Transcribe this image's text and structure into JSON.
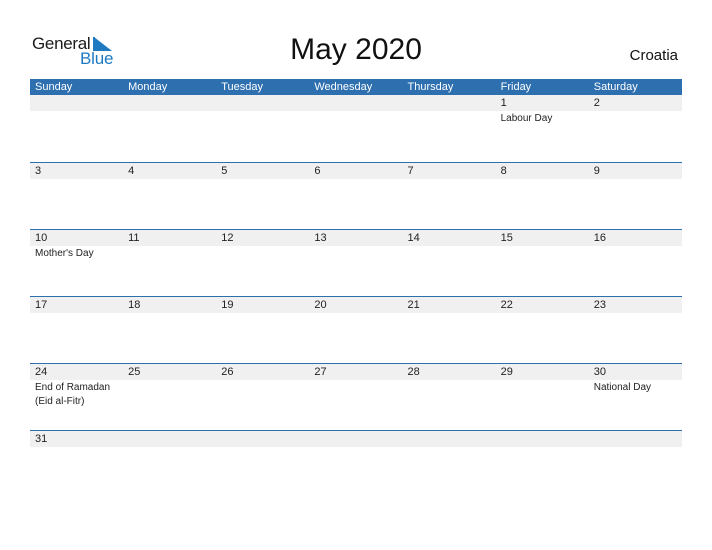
{
  "logo": {
    "line1": "General",
    "line2": "Blue"
  },
  "title": "May 2020",
  "country": "Croatia",
  "colors": {
    "header_bg": "#2e6fb0",
    "date_strip": "#f0f0f0",
    "brand_blue": "#1f7ac2"
  },
  "weekdays": [
    "Sunday",
    "Monday",
    "Tuesday",
    "Wednesday",
    "Thursday",
    "Friday",
    "Saturday"
  ],
  "weeks": [
    [
      {
        "day": "",
        "event": ""
      },
      {
        "day": "",
        "event": ""
      },
      {
        "day": "",
        "event": ""
      },
      {
        "day": "",
        "event": ""
      },
      {
        "day": "",
        "event": ""
      },
      {
        "day": "1",
        "event": "Labour Day"
      },
      {
        "day": "2",
        "event": ""
      }
    ],
    [
      {
        "day": "3",
        "event": ""
      },
      {
        "day": "4",
        "event": ""
      },
      {
        "day": "5",
        "event": ""
      },
      {
        "day": "6",
        "event": ""
      },
      {
        "day": "7",
        "event": ""
      },
      {
        "day": "8",
        "event": ""
      },
      {
        "day": "9",
        "event": ""
      }
    ],
    [
      {
        "day": "10",
        "event": "Mother's Day"
      },
      {
        "day": "11",
        "event": ""
      },
      {
        "day": "12",
        "event": ""
      },
      {
        "day": "13",
        "event": ""
      },
      {
        "day": "14",
        "event": ""
      },
      {
        "day": "15",
        "event": ""
      },
      {
        "day": "16",
        "event": ""
      }
    ],
    [
      {
        "day": "17",
        "event": ""
      },
      {
        "day": "18",
        "event": ""
      },
      {
        "day": "19",
        "event": ""
      },
      {
        "day": "20",
        "event": ""
      },
      {
        "day": "21",
        "event": ""
      },
      {
        "day": "22",
        "event": ""
      },
      {
        "day": "23",
        "event": ""
      }
    ],
    [
      {
        "day": "24",
        "event": "End of Ramadan\n(Eid al-Fitr)"
      },
      {
        "day": "25",
        "event": ""
      },
      {
        "day": "26",
        "event": ""
      },
      {
        "day": "27",
        "event": ""
      },
      {
        "day": "28",
        "event": ""
      },
      {
        "day": "29",
        "event": ""
      },
      {
        "day": "30",
        "event": "National Day"
      }
    ],
    [
      {
        "day": "31",
        "event": ""
      },
      {
        "day": "",
        "event": ""
      },
      {
        "day": "",
        "event": ""
      },
      {
        "day": "",
        "event": ""
      },
      {
        "day": "",
        "event": ""
      },
      {
        "day": "",
        "event": ""
      },
      {
        "day": "",
        "event": ""
      }
    ]
  ]
}
